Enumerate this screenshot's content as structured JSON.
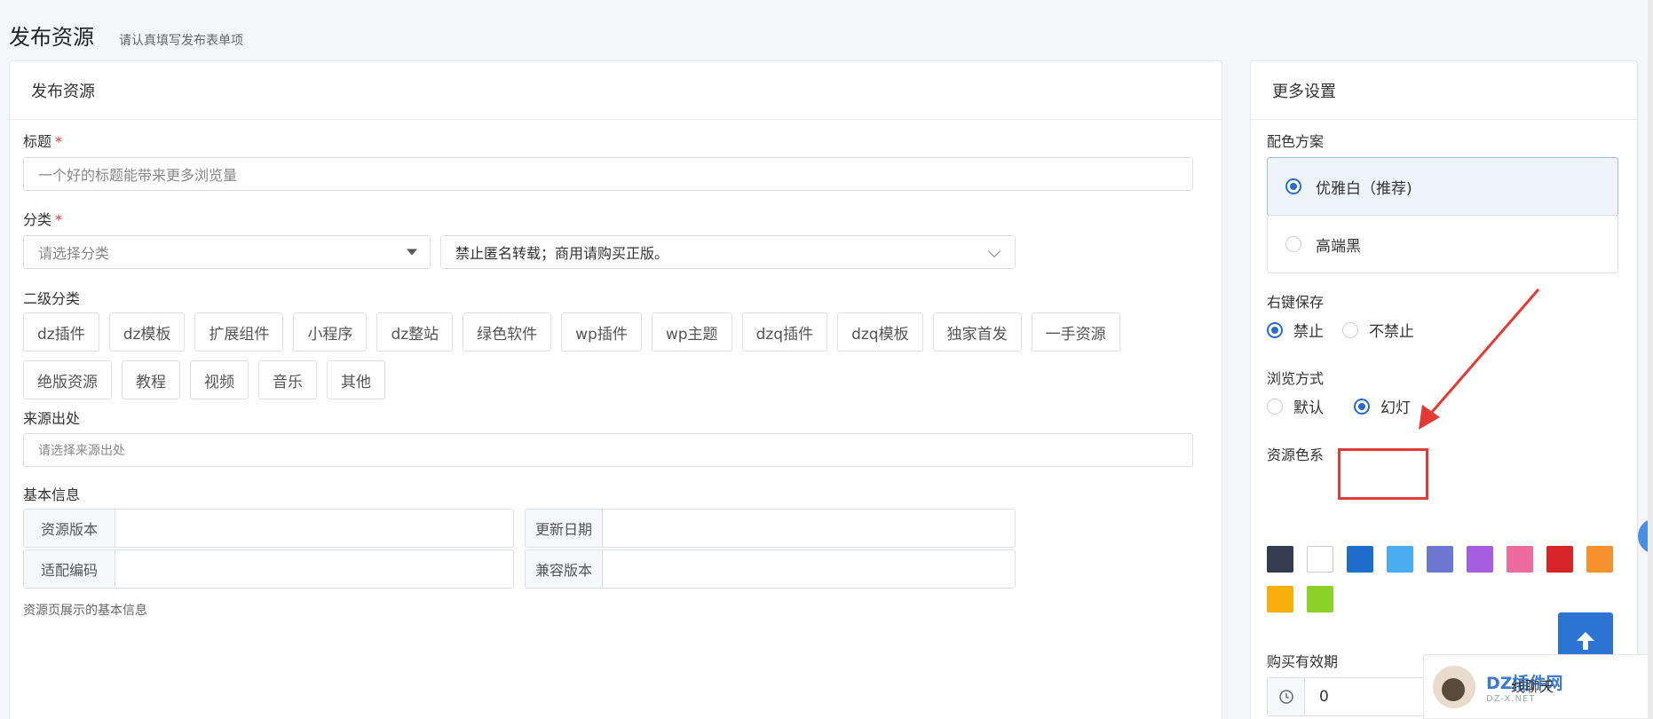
{
  "header": {
    "title": "发布资源",
    "subtitle": "请认真填写发布表单项"
  },
  "main": {
    "card_title": "发布资源",
    "title_field": {
      "label": "标题",
      "required_mark": "*",
      "placeholder": "一个好的标题能带来更多浏览量"
    },
    "category": {
      "label": "分类",
      "required_mark": "*",
      "select_value": "请选择分类",
      "notice_value": "禁止匿名转载；商用请购买正版。"
    },
    "subcategory": {
      "label": "二级分类",
      "tags": [
        "dz插件",
        "dz模板",
        "扩展组件",
        "小程序",
        "dz整站",
        "绿色软件",
        "wp插件",
        "wp主题",
        "dzq插件",
        "dzq模板",
        "独家首发",
        "一手资源",
        "绝版资源",
        "教程",
        "视频",
        "音乐",
        "其他"
      ]
    },
    "source": {
      "label": "来源出处",
      "placeholder": "请选择来源出处"
    },
    "basic_info": {
      "label": "基本信息",
      "fields": {
        "version": "资源版本",
        "update_date": "更新日期",
        "encoding": "适配编码",
        "compat": "兼容版本"
      },
      "hint": "资源页展示的基本信息"
    }
  },
  "side": {
    "card_title": "更多设置",
    "color_scheme": {
      "label": "配色方案",
      "options": [
        "优雅白（推荐)",
        "高端黑"
      ],
      "selected": 0
    },
    "right_click": {
      "label": "右键保存",
      "options": [
        "禁止",
        "不禁止"
      ],
      "selected": 0
    },
    "browse_mode": {
      "label": "浏览方式",
      "options": [
        "默认",
        "幻灯"
      ],
      "selected": 1
    },
    "resource_colors": {
      "label": "资源色系",
      "colors": [
        "#333d4d",
        "#ffffff",
        "#1f6fc9",
        "#49aef0",
        "#6b7ad0",
        "#a55ee0",
        "#ef6b9d",
        "#d42427",
        "#f5922c",
        "#f8b00d",
        "#8bd12a"
      ]
    },
    "validity": {
      "label": "购买有效期",
      "value": "0"
    }
  },
  "overlay": {
    "watermark_text": "DZ插件网",
    "watermark_sub": "DZ-X.NET",
    "chat_text": "线聊天",
    "back_to_top_icon": "arrow-up-icon"
  }
}
